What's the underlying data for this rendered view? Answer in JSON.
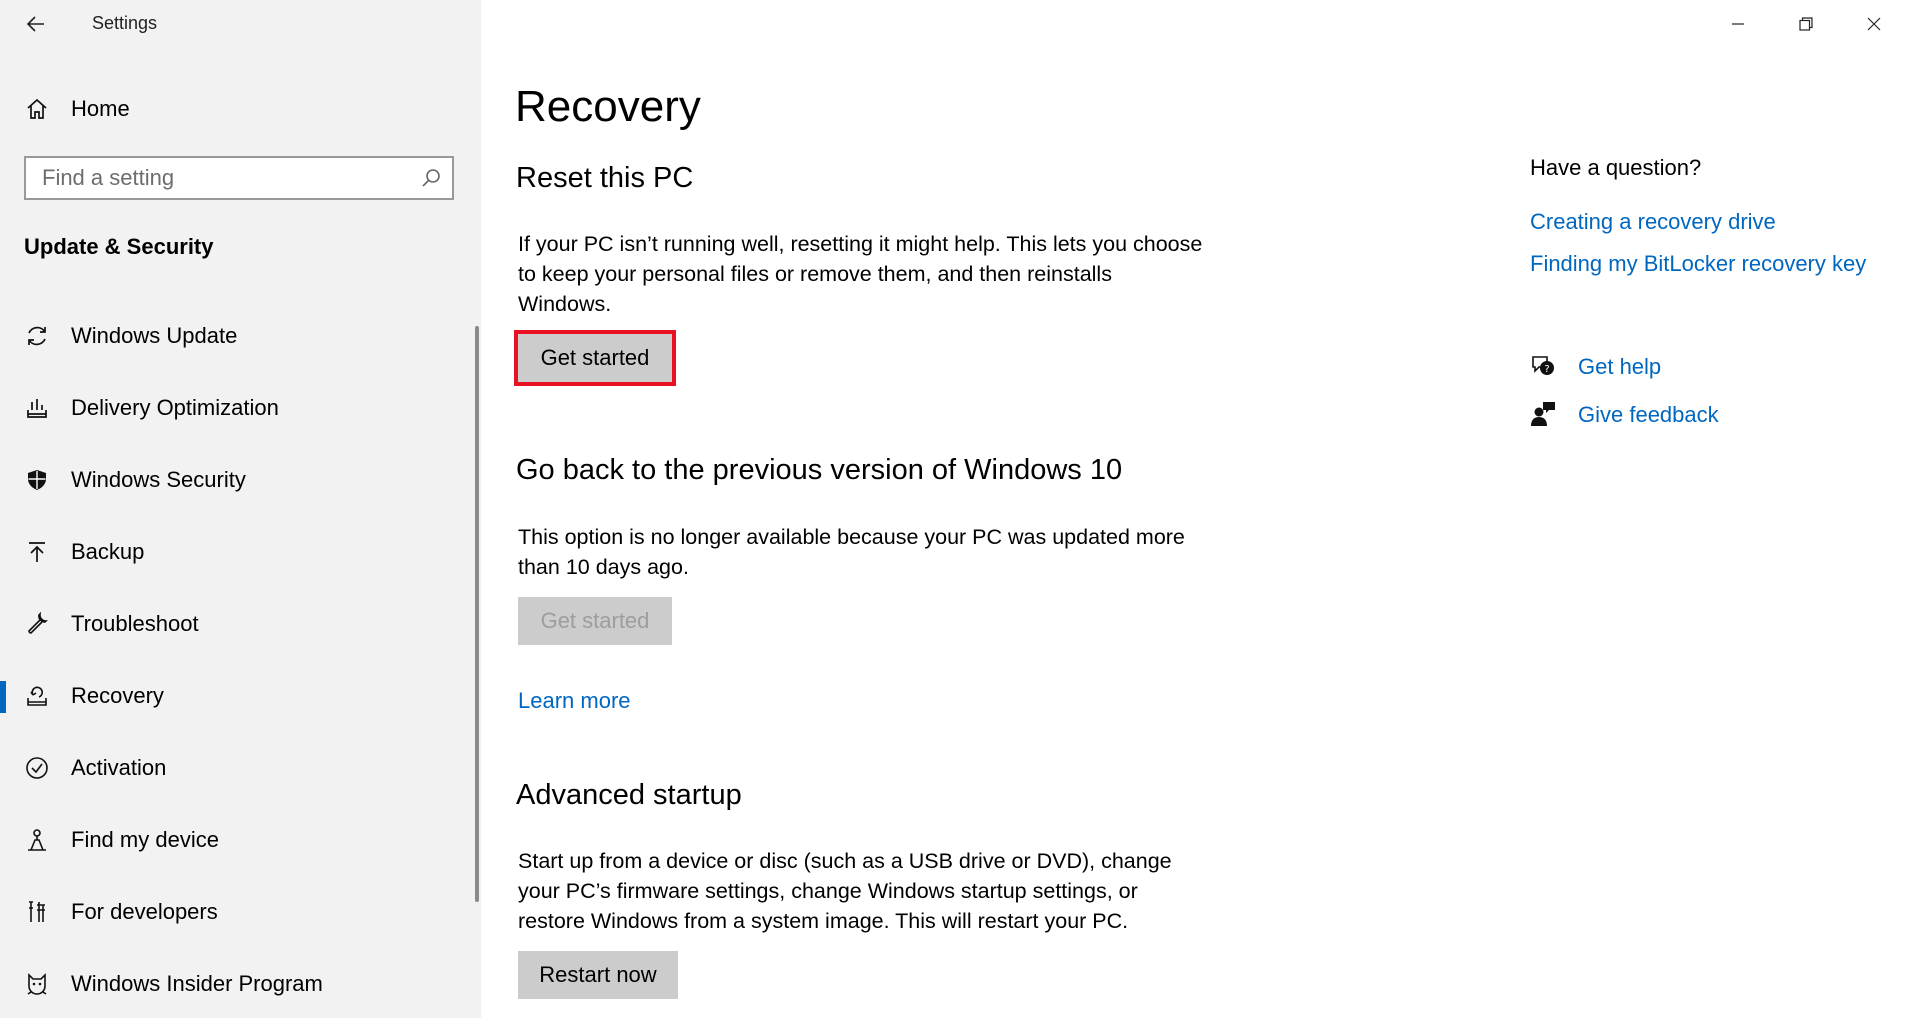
{
  "app": {
    "title": "Settings"
  },
  "sidebar": {
    "home_label": "Home",
    "search": {
      "placeholder": "Find a setting",
      "value": ""
    },
    "section_title": "Update & Security",
    "items": [
      {
        "label": "Windows Update",
        "icon": "sync-icon"
      },
      {
        "label": "Delivery Optimization",
        "icon": "delivery-optimization-icon"
      },
      {
        "label": "Windows Security",
        "icon": "shield-icon"
      },
      {
        "label": "Backup",
        "icon": "backup-arrow-icon"
      },
      {
        "label": "Troubleshoot",
        "icon": "wrench-icon"
      },
      {
        "label": "Recovery",
        "icon": "recovery-icon",
        "selected": true
      },
      {
        "label": "Activation",
        "icon": "check-circle-icon"
      },
      {
        "label": "Find my device",
        "icon": "person-location-icon"
      },
      {
        "label": "For developers",
        "icon": "developer-tools-icon"
      },
      {
        "label": "Windows Insider Program",
        "icon": "insider-cat-icon"
      }
    ]
  },
  "main": {
    "title": "Recovery",
    "reset": {
      "heading": "Reset this PC",
      "description": "If your PC isn’t running well, resetting it might help. This lets you choose to keep your personal files or remove them, and then reinstalls Windows.",
      "button": "Get started"
    },
    "go_back": {
      "heading": "Go back to the previous version of Windows 10",
      "description": "This option is no longer available because your PC was updated more than 10 days ago.",
      "button": "Get started",
      "learn_more": "Learn more"
    },
    "advanced": {
      "heading": "Advanced startup",
      "description": "Start up from a device or disc (such as a USB drive or DVD), change your PC’s firmware settings, change Windows startup settings, or restore Windows from a system image. This will restart your PC.",
      "button": "Restart now"
    }
  },
  "right_panel": {
    "heading": "Have a question?",
    "links": [
      "Creating a recovery drive",
      "Finding my BitLocker recovery key"
    ],
    "get_help": "Get help",
    "give_feedback": "Give feedback"
  },
  "colors": {
    "accent": "#0067c0",
    "focus_outline": "#e81123",
    "sidebar_bg": "#f2f2f2",
    "button_bg": "#cccccc"
  }
}
